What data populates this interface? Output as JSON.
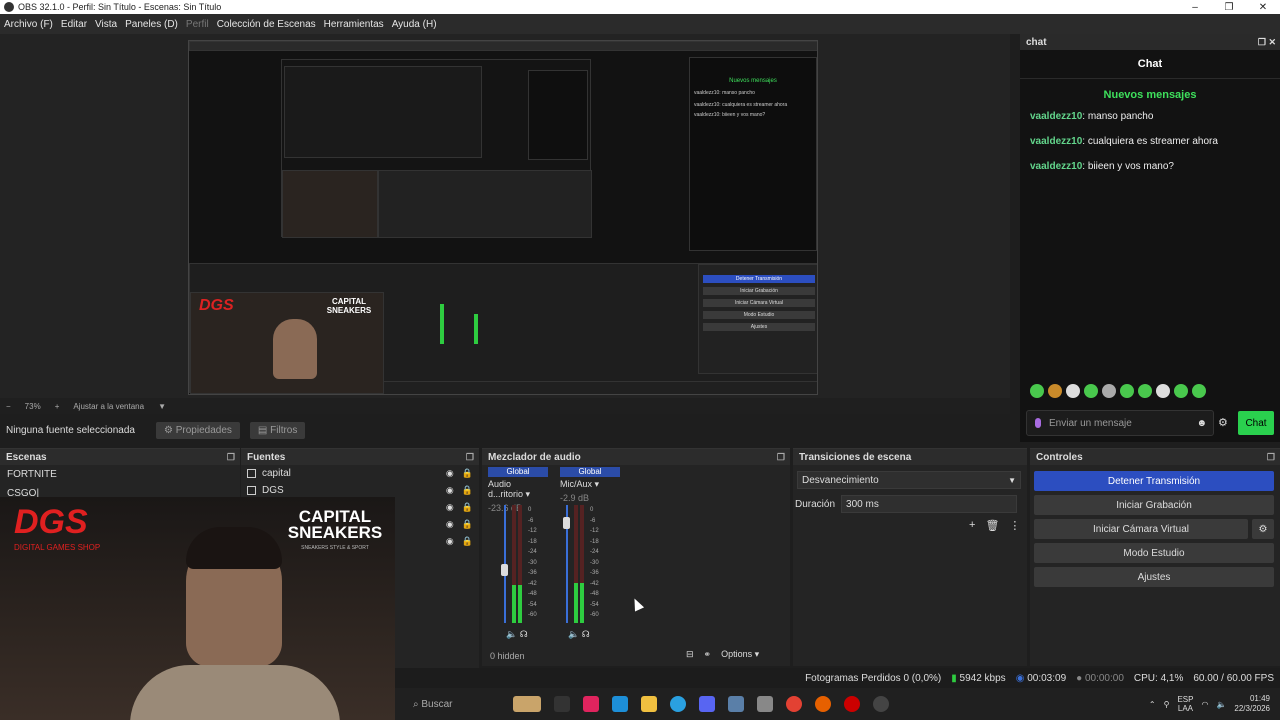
{
  "window": {
    "title": "OBS 32.1.0 - Perfil: Sin Título - Escenas: Sin Título"
  },
  "menu": [
    {
      "label": "Archivo (F)",
      "disabled": false
    },
    {
      "label": "Editar",
      "disabled": false
    },
    {
      "label": "Vista",
      "disabled": false
    },
    {
      "label": "Paneles (D)",
      "disabled": false
    },
    {
      "label": "Perfil",
      "disabled": true
    },
    {
      "label": "Colección de Escenas",
      "disabled": false
    },
    {
      "label": "Herramientas",
      "disabled": false
    },
    {
      "label": "Ayuda (H)",
      "disabled": false
    }
  ],
  "preview": {
    "zoom": "73%",
    "fit_label": "Ajustar a la ventana",
    "nested_chat_msgs": [
      "vaaldezz10: manso pancho",
      "vaaldezz10: cualquiera es streamer ahora",
      "vaaldezz10: biieen y vos mano?"
    ],
    "nested_controls": [
      "Detener Transmisión",
      "Iniciar Grabación",
      "Iniciar Cámara Virtual",
      "Modo Estudio",
      "Ajustes"
    ]
  },
  "source_bar": {
    "selected_label": "Ninguna fuente seleccionada",
    "properties_label": "Propiedades",
    "filters_label": "Filtros"
  },
  "chat": {
    "dock_title": "chat",
    "title": "Chat",
    "new_messages": "Nuevos mensajes",
    "messages": [
      {
        "user": "vaaldezz10",
        "text": ": manso pancho"
      },
      {
        "user": "vaaldezz10",
        "text": ": cualquiera es streamer ahora"
      },
      {
        "user": "vaaldezz10",
        "text": ": biieen y vos mano?"
      }
    ],
    "input_placeholder": "Enviar un mensaje",
    "send_label": "Chat"
  },
  "scenes": {
    "title": "Escenas",
    "items": [
      "FORTNITE",
      "CSGO|"
    ]
  },
  "sources": {
    "title": "Fuentes",
    "items": [
      "capital",
      "DGS"
    ]
  },
  "mixer": {
    "title": "Mezclador de audio",
    "channels": [
      {
        "global_label": "Global",
        "name": "Audio d...ritorio",
        "db": "-23.6 dB",
        "level": 0.32,
        "volume": 0.45
      },
      {
        "global_label": "Global",
        "name": "Mic/Aux",
        "db": "-2.9 dB",
        "level": 0.34,
        "volume": 0.85
      }
    ],
    "scale": [
      "0",
      "-6",
      "-12",
      "-18",
      "-24",
      "-30",
      "-36",
      "-42",
      "-48",
      "-54",
      "-60"
    ],
    "hidden_label": "0 hidden",
    "options_label": "Options"
  },
  "transitions": {
    "title": "Transiciones de escena",
    "selected": "Desvanecimiento",
    "duration_label": "Duración",
    "duration_value": "300 ms"
  },
  "controls": {
    "title": "Controles",
    "buttons": [
      "Detener Transmisión",
      "Iniciar Grabación",
      "Iniciar Cámara Virtual",
      "Modo Estudio",
      "Ajustes"
    ]
  },
  "webcam": {
    "logo_left": "DGS",
    "logo_left_sub": "DIGITAL GAMES SHOP",
    "logo_right": "CAPITAL SNEAKERS",
    "logo_right_sub": "SNEAKERS STYLE & SPORT"
  },
  "status": {
    "frames_dropped": "Fotogramas Perdidos 0 (0,0%)",
    "bitrate": "5942 kbps",
    "stream_time": "00:03:09",
    "rec_time": "00:00:00",
    "cpu": "CPU: 4,1%",
    "fps": "60.00 / 60.00 FPS"
  },
  "taskbar": {
    "search_label": "Buscar",
    "lang": "ESP",
    "lang_sub": "LAA",
    "time": "01:49",
    "date": "22/3/2026"
  },
  "colors": {
    "accent_blue": "#2c4ec0",
    "chat_green": "#2ad04e",
    "username_green": "#63d68c"
  }
}
